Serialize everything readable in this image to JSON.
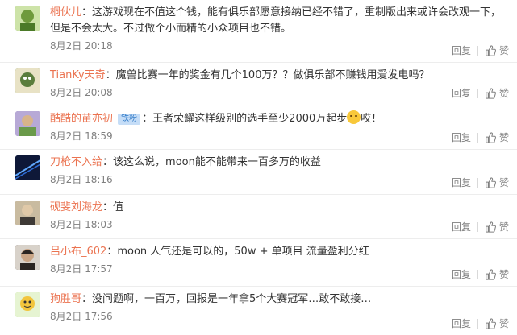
{
  "actions": {
    "reply": "回复",
    "like": "赞"
  },
  "comments": [
    {
      "user": "桐伙儿",
      "text": "这游戏现在不值这个钱，能有俱乐部愿意接纳已经不错了，重制版出来或许会改观一下，",
      "text2": "但是不会太大。不过做个小而精的小众项目也不错。",
      "time": "8月2日 20:18",
      "avatar_color": "#6f9a3d"
    },
    {
      "user": "TianKy天奇",
      "text": "魔兽比赛一年的奖金有几个100万？？做俱乐部不赚钱用爱发电吗？",
      "time": "8月2日 20:08",
      "avatar_color": "#5a7d3c"
    },
    {
      "user": "酷酷的苗亦初",
      "badge": "铁粉",
      "text": "王者荣耀这样级别的选手至少2000万起步",
      "text_after": "哎！",
      "time": "8月2日 18:59",
      "avatar_color": "#7a6ca8"
    },
    {
      "user": "刀枪不入给",
      "text": "该这么说，moon能不能带来一百多万的收益",
      "time": "8月2日 18:16",
      "avatar_color": "#1c2f6b"
    },
    {
      "user": "砚斐刘海龙",
      "text": "值",
      "time": "8月2日 18:03",
      "avatar_color": "#8a7a5c"
    },
    {
      "user": "吕小布_602",
      "text": "moon 人气还是可以的，50w + 单项目 流量盈利分红",
      "time": "8月2日 17:57",
      "avatar_color": "#3d3a38"
    },
    {
      "user": "狗胜哥",
      "text": "没问题啊，一百万，回报是一年拿5个大赛冠军…敢不敢接…",
      "time": "8月2日 17:56",
      "avatar_color": "#a6d66a"
    }
  ]
}
